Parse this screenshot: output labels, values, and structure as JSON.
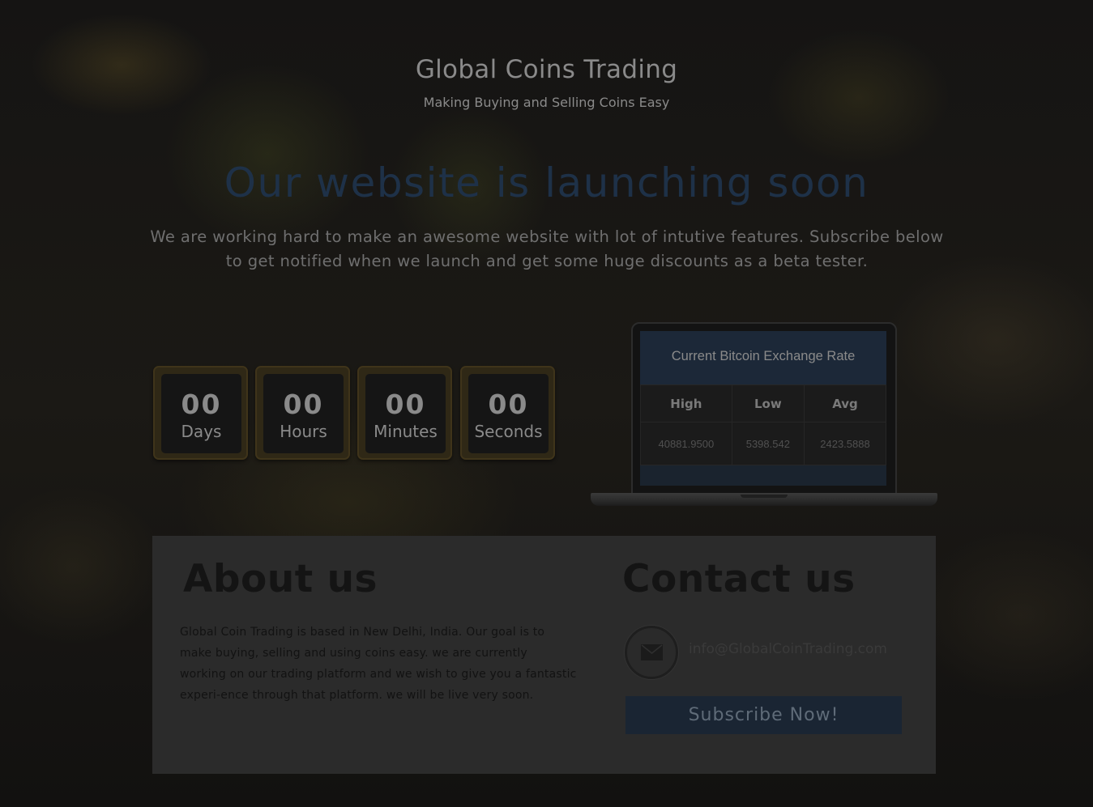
{
  "header": {
    "site_title": "Global Coins Trading",
    "tagline": "Making Buying and Selling Coins Easy"
  },
  "hero": {
    "headline": "Our website is launching soon",
    "lead": "We are working hard to make an awesome website with lot of intutive features. Subscribe below to get notified when we launch and get some huge discounts as a beta tester."
  },
  "countdown": [
    {
      "value": "00",
      "label": "Days"
    },
    {
      "value": "00",
      "label": "Hours"
    },
    {
      "value": "00",
      "label": "Minutes"
    },
    {
      "value": "00",
      "label": "Seconds"
    }
  ],
  "exchange": {
    "title": "Current Bitcoin Exchange Rate",
    "columns": [
      "High",
      "Low",
      "Avg"
    ],
    "values": [
      "40881.9500",
      "5398.542",
      "2423.5888"
    ]
  },
  "about": {
    "title": "About us",
    "text": "Global Coin Trading is based in New Delhi, India. Our goal is to make buying, selling and using coins easy. we are currently working on our trading platform and we wish to give you a fantastic experi-ence through that platform. we will be live very soon."
  },
  "contact": {
    "title": "Contact us",
    "email": "info@GlobalCoinTrading.com",
    "icon": "envelope-icon",
    "subscribe_label": "Subscribe  Now!"
  },
  "colors": {
    "headline": "#1e3148",
    "countdown_border": "#3f341a",
    "subscribe_bg": "#1a2533",
    "panel_bg": "#2b2b2b"
  }
}
